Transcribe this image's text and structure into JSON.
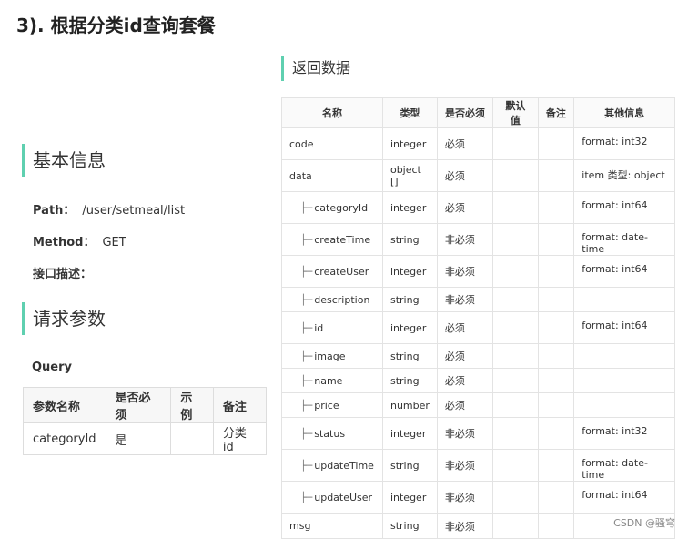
{
  "page_title": "3). 根据分类id查询套餐",
  "basic_info": {
    "heading": "基本信息",
    "path_label": "Path：",
    "path_value": "/user/setmeal/list",
    "method_label": "Method：",
    "method_value": "GET",
    "desc_label": "接口描述："
  },
  "request_params": {
    "heading": "请求参数",
    "query_label": "Query",
    "headers": [
      "参数名称",
      "是否必须",
      "示例",
      "备注"
    ],
    "row": [
      "categoryId",
      "是",
      "",
      "分类id"
    ]
  },
  "return_data": {
    "heading": "返回数据",
    "headers": [
      "名称",
      "类型",
      "是否必须",
      "默认值",
      "备注",
      "其他信息"
    ],
    "tree_prefix": "├─",
    "rows": [
      {
        "name": "code",
        "type": "integer",
        "required": "必须",
        "default": "",
        "note": "",
        "other": "format: int32"
      },
      {
        "name": "data",
        "type": "object []",
        "required": "必须",
        "default": "",
        "note": "",
        "other": "item 类型: object"
      },
      {
        "name": "categoryId",
        "type": "integer",
        "required": "必须",
        "default": "",
        "note": "",
        "other": "format: int64"
      },
      {
        "name": "createTime",
        "type": "string",
        "required": "非必须",
        "default": "",
        "note": "",
        "other": "format: date-time"
      },
      {
        "name": "createUser",
        "type": "integer",
        "required": "非必须",
        "default": "",
        "note": "",
        "other": "format: int64"
      },
      {
        "name": "description",
        "type": "string",
        "required": "非必须",
        "default": "",
        "note": "",
        "other": ""
      },
      {
        "name": "id",
        "type": "integer",
        "required": "必须",
        "default": "",
        "note": "",
        "other": "format: int64"
      },
      {
        "name": "image",
        "type": "string",
        "required": "必须",
        "default": "",
        "note": "",
        "other": ""
      },
      {
        "name": "name",
        "type": "string",
        "required": "必须",
        "default": "",
        "note": "",
        "other": ""
      },
      {
        "name": "price",
        "type": "number",
        "required": "必须",
        "default": "",
        "note": "",
        "other": ""
      },
      {
        "name": "status",
        "type": "integer",
        "required": "非必须",
        "default": "",
        "note": "",
        "other": "format: int32"
      },
      {
        "name": "updateTime",
        "type": "string",
        "required": "非必须",
        "default": "",
        "note": "",
        "other": "format: date-time"
      },
      {
        "name": "updateUser",
        "type": "integer",
        "required": "非必须",
        "default": "",
        "note": "",
        "other": "format: int64"
      },
      {
        "name": "msg",
        "type": "string",
        "required": "非必须",
        "default": "",
        "note": "",
        "other": ""
      }
    ]
  },
  "watermark": "CSDN @骚穹"
}
